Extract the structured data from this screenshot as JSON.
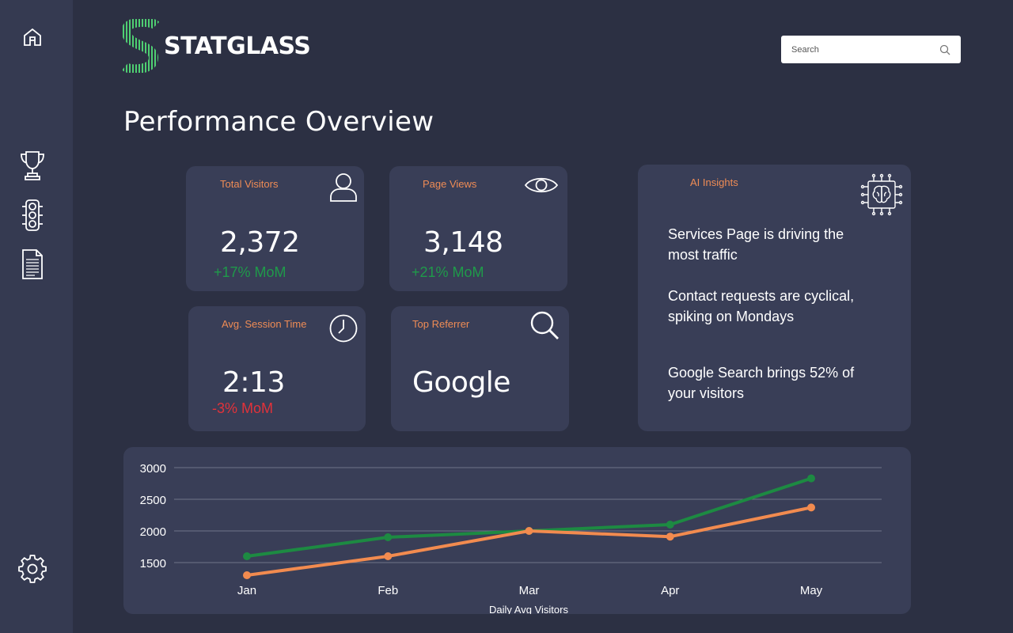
{
  "app": {
    "logo_text": "STATGLASS"
  },
  "sidebar": {
    "items": [
      {
        "icon": "home-icon"
      },
      {
        "icon": "trophy-icon"
      },
      {
        "icon": "traffic-light-icon"
      },
      {
        "icon": "document-icon"
      },
      {
        "icon": "gear-icon"
      }
    ]
  },
  "search": {
    "placeholder": "Search",
    "value": ""
  },
  "page": {
    "title": "Performance Overview"
  },
  "metrics": {
    "total_visitors": {
      "label": "Total Visitors",
      "value": "2,372",
      "change": "+17% MoM",
      "icon": "user-icon"
    },
    "page_views": {
      "label": "Page Views",
      "value": "3,148",
      "change": "+21% MoM",
      "icon": "eye-icon"
    },
    "avg_session": {
      "label": "Avg. Session Time",
      "value": "2:13",
      "change": "-3% MoM",
      "icon": "clock-icon"
    },
    "top_referrer": {
      "label": "Top Referrer",
      "value": "Google",
      "icon": "search-icon"
    }
  },
  "insights": {
    "label": "AI Insights",
    "icon": "ai-brain-chip-icon",
    "items": [
      "Services Page is driving the most traffic",
      "Contact requests are cyclical, spiking on Mondays",
      "Google Search brings 52% of your visitors"
    ]
  },
  "colors": {
    "accent_orange": "#ef8c55",
    "positive": "#1f9a4a",
    "negative": "#e2323a",
    "series_green": "#1d8a42",
    "series_orange": "#f28b4f"
  },
  "chart_data": {
    "type": "line",
    "categories": [
      "Jan",
      "Feb",
      "Mar",
      "Apr",
      "May"
    ],
    "series": [
      {
        "color": "#1d8a42",
        "values": [
          1600,
          1900,
          2000,
          2100,
          2830
        ]
      },
      {
        "color": "#f28b4f",
        "values": [
          1300,
          1600,
          2000,
          1910,
          2370
        ]
      }
    ],
    "title": "",
    "xlabel": "Daily Avg Visitors",
    "ylabel": "",
    "yticks": [
      1500,
      2000,
      2500,
      3000
    ],
    "ylim": [
      1500,
      3000
    ],
    "grid": true,
    "legend": "none"
  }
}
